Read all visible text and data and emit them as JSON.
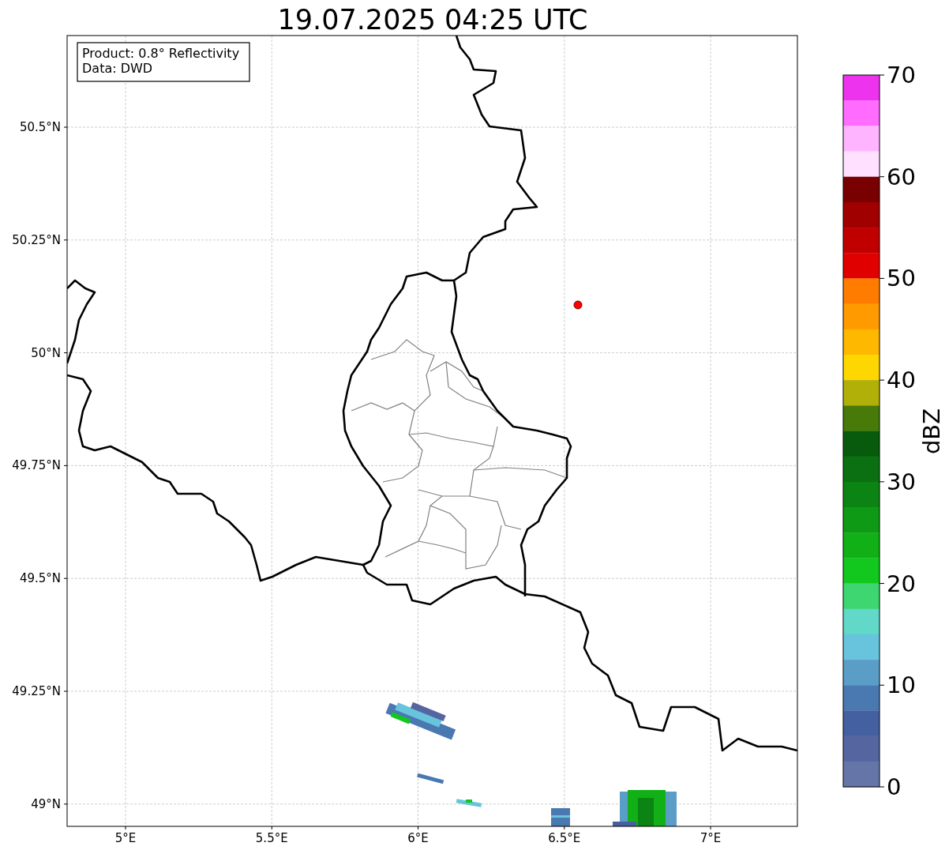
{
  "title": "19.07.2025 04:25 UTC",
  "info_box": {
    "lines": [
      "Product: 0.8° Reflectivity",
      "Data: DWD"
    ]
  },
  "map": {
    "xticks": [
      "5°E",
      "5.5°E",
      "6°E",
      "6.5°E",
      "7°E"
    ],
    "yticks": [
      "50.5°N",
      "50.25°N",
      "50°N",
      "49.75°N",
      "49.5°N",
      "49.25°N",
      "49°N"
    ]
  },
  "colorbar": {
    "label": "dBZ",
    "ticks": [
      "70",
      "60",
      "50",
      "40",
      "30",
      "20",
      "10",
      "0"
    ],
    "bins": [
      {
        "color": "#ee33ee"
      },
      {
        "color": "#ff6cff"
      },
      {
        "color": "#ffb4ff"
      },
      {
        "color": "#ffe0ff"
      },
      {
        "color": "#780000"
      },
      {
        "color": "#a00000"
      },
      {
        "color": "#c00000"
      },
      {
        "color": "#e00000"
      },
      {
        "color": "#ff7c00"
      },
      {
        "color": "#ff9a00"
      },
      {
        "color": "#ffb800"
      },
      {
        "color": "#ffd700"
      },
      {
        "color": "#b0b008"
      },
      {
        "color": "#487a0a"
      },
      {
        "color": "#085a0c"
      },
      {
        "color": "#0a7012"
      },
      {
        "color": "#0c8414"
      },
      {
        "color": "#0e9a14"
      },
      {
        "color": "#10b016"
      },
      {
        "color": "#12c81e"
      },
      {
        "color": "#3dd670"
      },
      {
        "color": "#62d8c8"
      },
      {
        "color": "#67c4dc"
      },
      {
        "color": "#5a9ec8"
      },
      {
        "color": "#4a78b0"
      },
      {
        "color": "#4460a0"
      },
      {
        "color": "#5565a0"
      },
      {
        "color": "#6675a8"
      }
    ]
  }
}
